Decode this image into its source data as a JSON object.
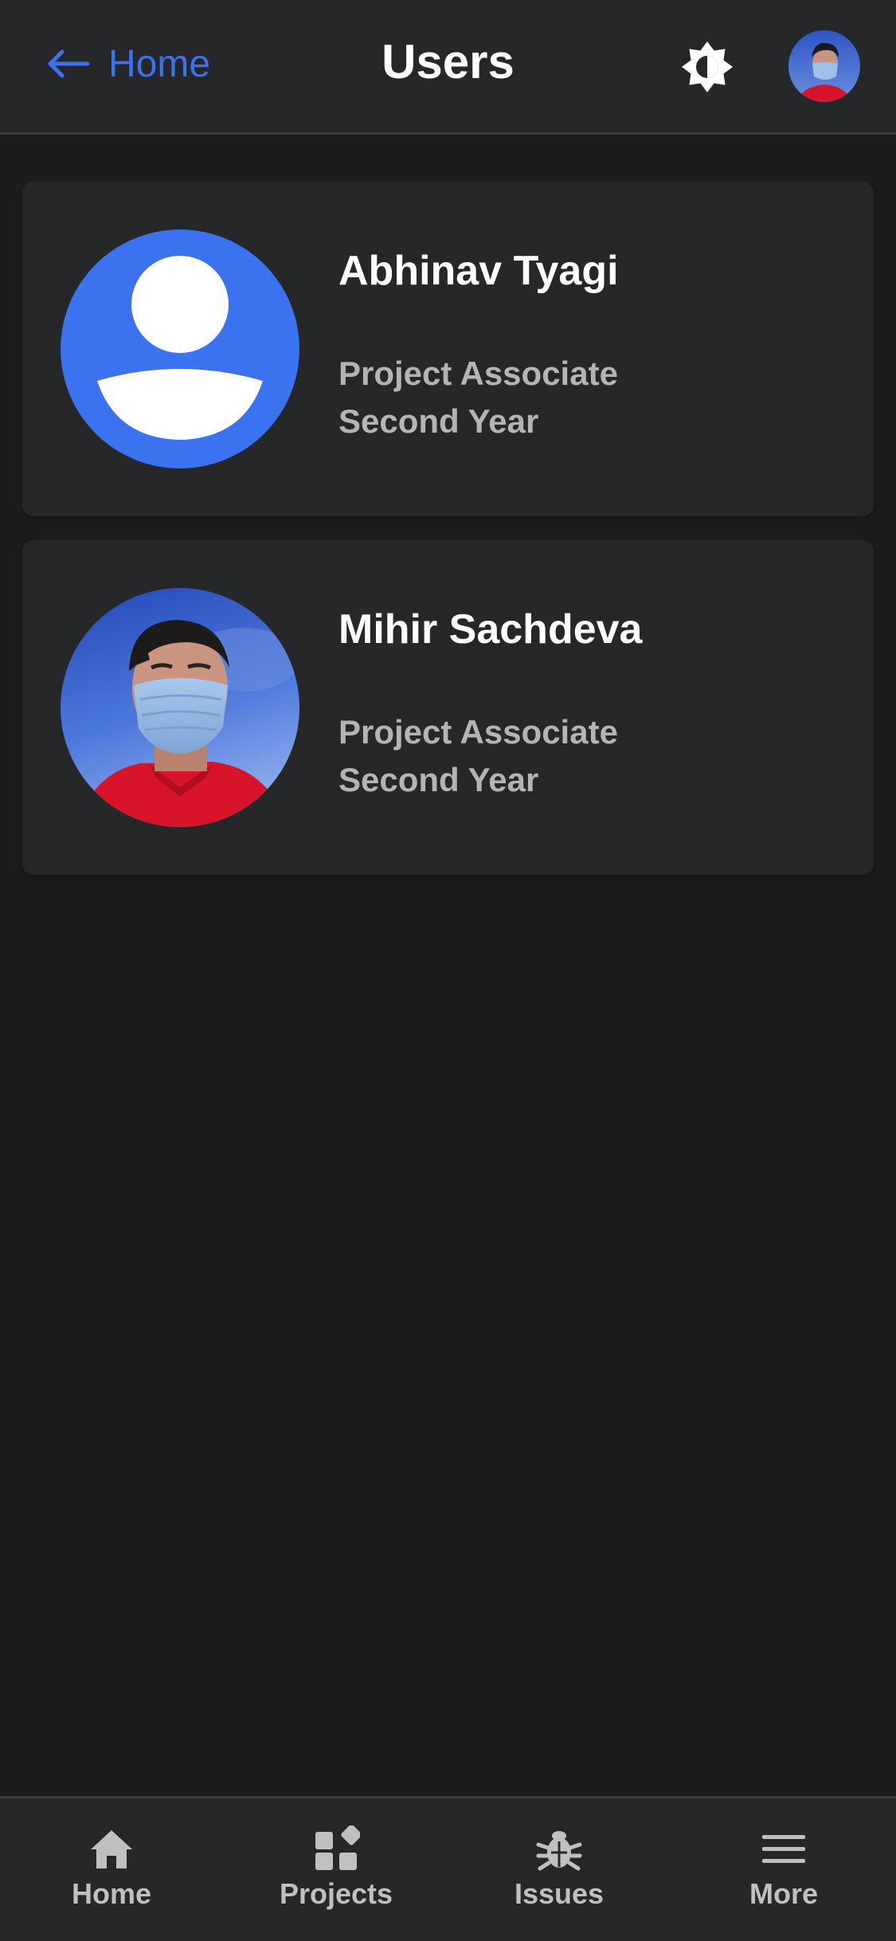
{
  "header": {
    "back_label": "Home",
    "title": "Users",
    "back_icon": "arrow-left-icon",
    "theme_icon": "brightness-icon"
  },
  "users": [
    {
      "name": "Abhinav Tyagi",
      "role": "Project Associate",
      "year": "Second Year",
      "avatar": "default-avatar-icon"
    },
    {
      "name": "Mihir Sachdeva",
      "role": "Project Associate",
      "year": "Second Year",
      "avatar": "profile-photo"
    }
  ],
  "nav": {
    "items": [
      {
        "label": "Home",
        "icon": "home-icon"
      },
      {
        "label": "Projects",
        "icon": "projects-icon"
      },
      {
        "label": "Issues",
        "icon": "bug-icon"
      },
      {
        "label": "More",
        "icon": "menu-icon"
      }
    ]
  },
  "colors": {
    "accent": "#3a72f0",
    "background": "#1b1c1e",
    "surface": "#262729",
    "text_primary": "#ffffff",
    "text_secondary": "#b4b4b6"
  }
}
